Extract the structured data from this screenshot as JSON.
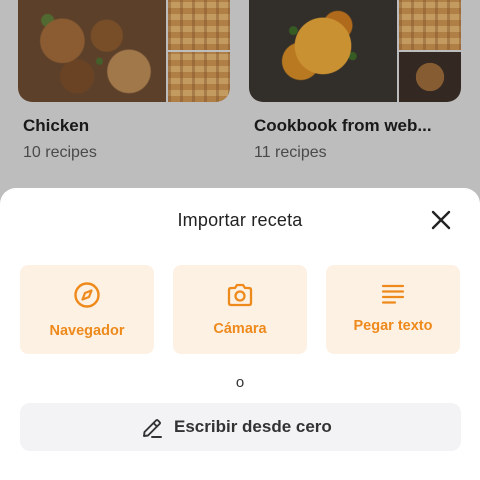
{
  "collections": [
    {
      "title": "Chicken",
      "count": "10 recipes"
    },
    {
      "title": "Cookbook from web...",
      "count": "11 recipes"
    }
  ],
  "sheet": {
    "title": "Importar receta",
    "close_icon": "close-icon",
    "options": [
      {
        "label": "Navegador",
        "icon": "compass-icon"
      },
      {
        "label": "Cámara",
        "icon": "camera-icon"
      },
      {
        "label": "Pegar texto",
        "icon": "text-lines-icon"
      }
    ],
    "separator": "o",
    "scratch_label": "Escribir desde cero",
    "scratch_icon": "pencil-icon"
  },
  "colors": {
    "accent": "#ee8a1c",
    "option_bg": "#fdf1e4",
    "scratch_bg": "#f3f3f6"
  }
}
